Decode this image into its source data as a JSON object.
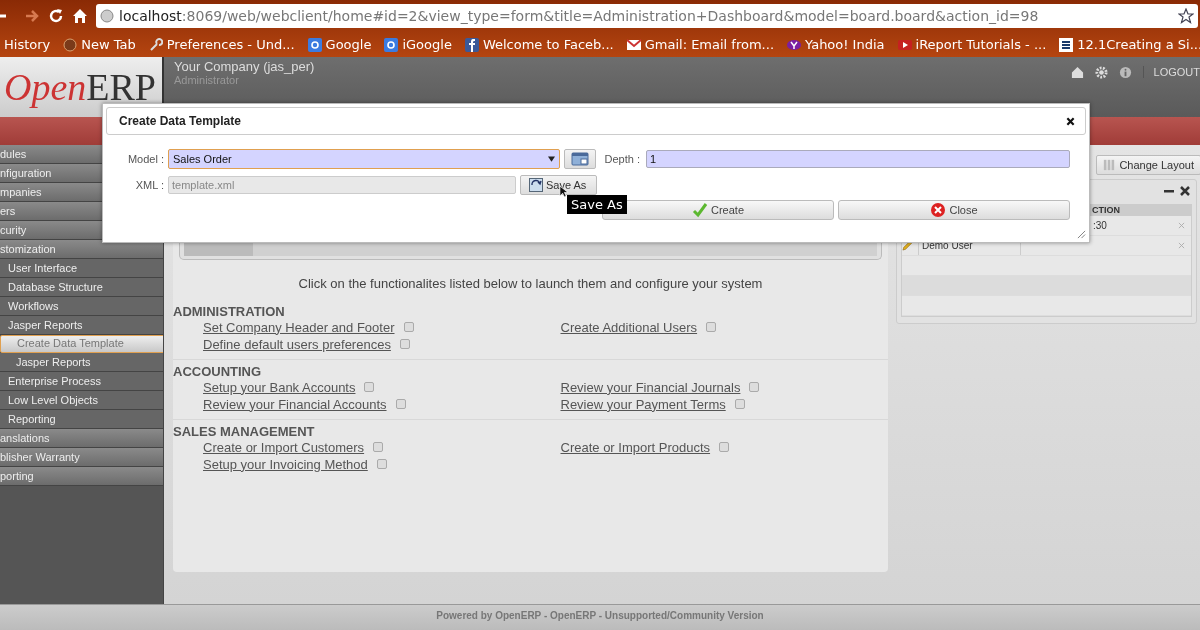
{
  "browser": {
    "url_host": "localhost",
    "url_rest": ":8069/web/webclient/home#id=2&view_type=form&title=Administration+Dashboard&model=board.board&action_id=98",
    "bookmarks": [
      {
        "label": "History",
        "kind": "none"
      },
      {
        "label": "New Tab",
        "kind": "globe"
      },
      {
        "label": "Preferences - Und...",
        "kind": "wrench"
      },
      {
        "label": "Google",
        "kind": "google"
      },
      {
        "label": "iGoogle",
        "kind": "google"
      },
      {
        "label": "Welcome to Faceb...",
        "kind": "facebook"
      },
      {
        "label": "Gmail: Email from...",
        "kind": "mail"
      },
      {
        "label": "Yahoo! India",
        "kind": "yahoo"
      },
      {
        "label": "iReport Tutorials - ...",
        "kind": "video"
      },
      {
        "label": "12.1Creating a Si...",
        "kind": "scribd"
      }
    ]
  },
  "header": {
    "logo_left": "Open",
    "logo_right": "ERP",
    "company": "Your Company (jas_per)",
    "user": "Administrator",
    "logout": "LOGOUT"
  },
  "sidebar": {
    "items": [
      {
        "label": "dules",
        "kind": "section",
        "selected": false
      },
      {
        "label": "nfiguration",
        "kind": "section",
        "selected": false
      },
      {
        "label": "mpanies",
        "kind": "section",
        "selected": false
      },
      {
        "label": "ers",
        "kind": "section",
        "selected": false
      },
      {
        "label": "curity",
        "kind": "section",
        "selected": false
      },
      {
        "label": "stomization",
        "kind": "section",
        "selected": false,
        "children": [
          {
            "label": "User Interface",
            "kind": "item",
            "selected": false
          },
          {
            "label": "Database Structure",
            "kind": "item",
            "selected": false
          },
          {
            "label": "Workflows",
            "kind": "item",
            "selected": false
          },
          {
            "label": "Jasper Reports",
            "kind": "item",
            "selected": false,
            "children": [
              {
                "label": "Create Data Template",
                "kind": "item",
                "selected": true
              },
              {
                "label": "Jasper Reports",
                "kind": "item",
                "selected": false
              }
            ]
          },
          {
            "label": "Enterprise Process",
            "kind": "item",
            "selected": false
          },
          {
            "label": "Low Level Objects",
            "kind": "item",
            "selected": false
          },
          {
            "label": "Reporting",
            "kind": "item",
            "selected": false
          }
        ]
      },
      {
        "label": "anslations",
        "kind": "section",
        "selected": false
      },
      {
        "label": "blisher Warranty",
        "kind": "section",
        "selected": false
      },
      {
        "label": "porting",
        "kind": "section",
        "selected": false
      }
    ]
  },
  "dashboard": {
    "intro": "Click on the functionalites listed below to launch them and configure your system",
    "sections": [
      {
        "title": "ADMINISTRATION",
        "left": [
          {
            "label": "Set Company Header and Footer",
            "checked": false
          },
          {
            "label": "Define default users preferences",
            "checked": false
          }
        ],
        "right": [
          {
            "label": "Create Additional Users",
            "checked": false
          }
        ]
      },
      {
        "title": "ACCOUNTING",
        "left": [
          {
            "label": "Setup your Bank Accounts",
            "checked": false
          },
          {
            "label": "Review your Financial Accounts",
            "checked": false
          }
        ],
        "right": [
          {
            "label": "Review your Financial Journals",
            "checked": false
          },
          {
            "label": "Review your Payment Terms",
            "checked": false
          }
        ]
      },
      {
        "title": "SALES MANAGEMENT",
        "left": [
          {
            "label": "Create or Import Customers",
            "checked": false
          },
          {
            "label": "Setup your Invoicing Method",
            "checked": false
          }
        ],
        "right": [
          {
            "label": "Create or Import Products",
            "checked": false
          }
        ]
      }
    ]
  },
  "right_panel": {
    "change_layout": "Change Layout",
    "column_header": "CTION",
    "rows": [
      {
        "name": "",
        "value": ":30",
        "kind": "plain"
      },
      {
        "name": "Demo User",
        "value": "",
        "kind": "editable"
      }
    ]
  },
  "modal": {
    "title": "Create Data Template",
    "model_label": "Model :",
    "model_value": "Sales Order",
    "depth_label": "Depth :",
    "depth_value": "1",
    "xml_label": "XML :",
    "xml_value": "template.xml",
    "save_as": "Save As",
    "tooltip": "Save As",
    "create": "Create",
    "close": "Close"
  },
  "footer": "Powered by OpenERP - OpenERP - Unsupported/Community Version"
}
